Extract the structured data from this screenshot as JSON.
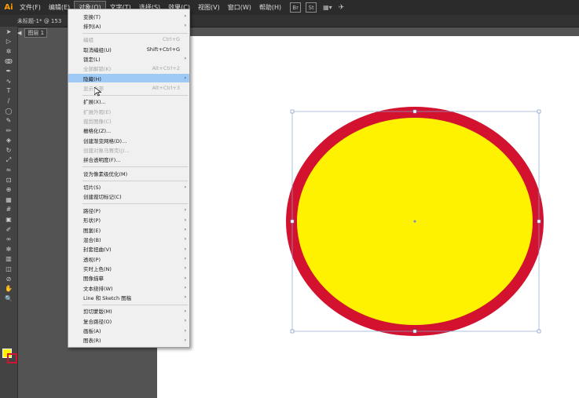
{
  "app": {
    "logo": "Ai"
  },
  "menubar": {
    "items": [
      "文件(F)",
      "编辑(E)",
      "对象(O)",
      "文字(T)",
      "选择(S)",
      "效果(C)",
      "视图(V)",
      "窗口(W)",
      "帮助(H)"
    ],
    "active_index": 2,
    "extra_icons": [
      "Br",
      "St"
    ]
  },
  "document": {
    "tab_title": "未标题-1* @ 153"
  },
  "breadcrumb": {
    "layer": "图层 1"
  },
  "object_menu": {
    "items": [
      {
        "label": "变换(T)",
        "shortcut": "",
        "submenu": true,
        "disabled": false
      },
      {
        "label": "排列(A)",
        "shortcut": "",
        "submenu": true,
        "disabled": false
      },
      {
        "sep": true
      },
      {
        "label": "编组",
        "shortcut": "Ctrl+G",
        "submenu": false,
        "disabled": true
      },
      {
        "label": "取消编组(U)",
        "shortcut": "Shift+Ctrl+G",
        "submenu": false,
        "disabled": false
      },
      {
        "label": "锁定(L)",
        "shortcut": "",
        "submenu": true,
        "disabled": false
      },
      {
        "label": "全部解锁(K)",
        "shortcut": "Alt+Ctrl+2",
        "submenu": false,
        "disabled": true
      },
      {
        "label": "隐藏(H)",
        "shortcut": "",
        "submenu": true,
        "disabled": false,
        "highlight": true
      },
      {
        "label": "显示全部",
        "shortcut": "Alt+Ctrl+3",
        "submenu": false,
        "disabled": true
      },
      {
        "sep": true
      },
      {
        "label": "扩展(X)...",
        "shortcut": "",
        "submenu": false,
        "disabled": false
      },
      {
        "label": "扩展外观(E)",
        "shortcut": "",
        "submenu": false,
        "disabled": true
      },
      {
        "label": "裁剪图像(C)",
        "shortcut": "",
        "submenu": false,
        "disabled": true
      },
      {
        "label": "栅格化(Z)...",
        "shortcut": "",
        "submenu": false,
        "disabled": false
      },
      {
        "label": "创建渐变网格(D)...",
        "shortcut": "",
        "submenu": false,
        "disabled": false
      },
      {
        "label": "创建对象马赛克(J)...",
        "shortcut": "",
        "submenu": false,
        "disabled": true
      },
      {
        "label": "拼合透明度(F)...",
        "shortcut": "",
        "submenu": false,
        "disabled": false
      },
      {
        "sep": true
      },
      {
        "label": "设为像素级优化(M)",
        "shortcut": "",
        "submenu": false,
        "disabled": false
      },
      {
        "sep": true
      },
      {
        "label": "切片(S)",
        "shortcut": "",
        "submenu": true,
        "disabled": false
      },
      {
        "label": "创建裁切标记(C)",
        "shortcut": "",
        "submenu": false,
        "disabled": false
      },
      {
        "sep": true
      },
      {
        "label": "路径(P)",
        "shortcut": "",
        "submenu": true,
        "disabled": false
      },
      {
        "label": "形状(P)",
        "shortcut": "",
        "submenu": true,
        "disabled": false
      },
      {
        "label": "图案(E)",
        "shortcut": "",
        "submenu": true,
        "disabled": false
      },
      {
        "label": "混合(B)",
        "shortcut": "",
        "submenu": true,
        "disabled": false
      },
      {
        "label": "封套扭曲(V)",
        "shortcut": "",
        "submenu": true,
        "disabled": false
      },
      {
        "label": "透视(P)",
        "shortcut": "",
        "submenu": true,
        "disabled": false
      },
      {
        "label": "实时上色(N)",
        "shortcut": "",
        "submenu": true,
        "disabled": false
      },
      {
        "label": "图像描摹",
        "shortcut": "",
        "submenu": true,
        "disabled": false
      },
      {
        "label": "文本绕排(W)",
        "shortcut": "",
        "submenu": true,
        "disabled": false
      },
      {
        "label": "Line 和 Sketch 图稿",
        "shortcut": "",
        "submenu": true,
        "disabled": false
      },
      {
        "sep": true
      },
      {
        "label": "剪切蒙版(M)",
        "shortcut": "",
        "submenu": true,
        "disabled": false
      },
      {
        "label": "复合路径(O)",
        "shortcut": "",
        "submenu": true,
        "disabled": false
      },
      {
        "label": "画板(A)",
        "shortcut": "",
        "submenu": true,
        "disabled": false
      },
      {
        "label": "图表(R)",
        "shortcut": "",
        "submenu": true,
        "disabled": false
      }
    ]
  },
  "artwork": {
    "fill_color": "#fff200",
    "stroke_color": "#d2122e"
  },
  "toolbar": {
    "tools": [
      "selection-tool",
      "direct-selection-tool",
      "magic-wand-tool",
      "lasso-tool",
      "pen-tool",
      "curvature-tool",
      "type-tool",
      "line-tool",
      "ellipse-tool",
      "paintbrush-tool",
      "pencil-tool",
      "eraser-tool",
      "rotate-tool",
      "scale-tool",
      "width-tool",
      "free-transform-tool",
      "shape-builder-tool",
      "perspective-tool",
      "mesh-tool",
      "gradient-tool",
      "eyedropper-tool",
      "blend-tool",
      "symbol-sprayer-tool",
      "column-graph-tool",
      "artboard-tool",
      "slice-tool",
      "hand-tool",
      "zoom-tool"
    ]
  }
}
